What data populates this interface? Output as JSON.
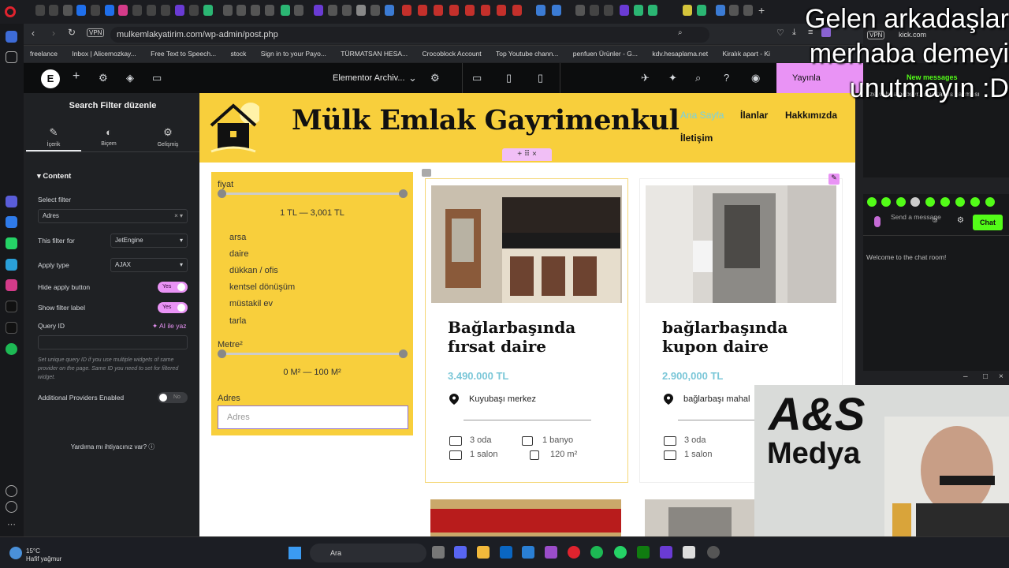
{
  "browser": {
    "url": "mulkemlakyatirim.com/wp-admin/post.php",
    "vpn_label": "VPN",
    "bookmarks": [
      "freelance",
      "Inbox | Alicemozkay...",
      "Free Text to Speech...",
      "stock",
      "Sign in to your Payo...",
      "TÜRMATSAN HESA...",
      "Crocoblock Account",
      "Top Youtube chann...",
      "penfuen Ürünler - G...",
      "kdv.hesaplama.net",
      "Kiralık apart - Ki"
    ]
  },
  "elementor": {
    "document_title": "Elementor Archiv...",
    "publish_label": "Yayınla",
    "panel": {
      "title": "Search Filter düzenle",
      "tabs": [
        "İçerik",
        "Biçem",
        "Gelişmiş"
      ],
      "section": "Content",
      "select_filter_label": "Select filter",
      "select_filter_value": "Adres",
      "this_filter_for_label": "This filter for",
      "this_filter_for_value": "JetEngine",
      "apply_type_label": "Apply type",
      "apply_type_value": "AJAX",
      "hide_apply_label": "Hide apply button",
      "hide_apply_value": "Yes",
      "show_label_label": "Show filter label",
      "show_label_value": "Yes",
      "query_id_label": "Query ID",
      "ai_label": "AI ile yaz",
      "query_help": "Set unique query ID if you use multiple widgets of same provider on the page. Same ID you need to set for filtered widget.",
      "additional_label": "Additional Providers Enabled",
      "additional_value": "No",
      "help": "Yardıma mı ihtiyacınız var?"
    }
  },
  "site": {
    "title": "Mülk Emlak Gayrimenkul",
    "nav": [
      "Ana Sayfa",
      "İlanlar",
      "Hakkımızda",
      "İletişim"
    ],
    "filter": {
      "price_label": "fiyat",
      "price_range": "1 TL — 3,001 TL",
      "categories": [
        "arsa",
        "daire",
        "dükkan / ofis",
        "kentsel dönüşüm",
        "müstakil ev",
        "tarla"
      ],
      "area_label": "Metre²",
      "area_range": "0 M² — 100 M²",
      "address_label": "Adres",
      "address_placeholder": "Adres"
    },
    "listings": [
      {
        "title": "Bağlarbaşında fırsat daire",
        "price": "3.490.000 TL",
        "location": "Kuyubaşı merkez",
        "rooms": "3 oda",
        "salon": "1 salon",
        "bath": "1 banyo",
        "area": "120 m²"
      },
      {
        "title": "bağlarbaşında kupon daire",
        "price": "2.900,000 TL",
        "location": "bağlarbaşı mahal",
        "rooms": "3 oda",
        "salon": "1 salon"
      }
    ]
  },
  "stream": {
    "overlay_text": "Gelen arkadaşlar merhaba demeyi unutmayın :D",
    "chat_site": "kick.com",
    "new_messages": "New messages",
    "preview_msg": "zeyrob: aloobsyr...ona tavus çakması",
    "send_placeholder": "Send a message",
    "chat_button": "Chat",
    "welcome": "Welcome to the chat room!",
    "logo_line1": "A&S",
    "logo_line2": "Medya"
  },
  "taskbar": {
    "temp": "15°C",
    "weather": "Hafif yağmur",
    "search": "Ara"
  },
  "colors": {
    "accent": "#e993f5",
    "header_yellow": "#f8cf3c",
    "price_blue": "#7bc7d8",
    "kick_green": "#53fc18"
  }
}
